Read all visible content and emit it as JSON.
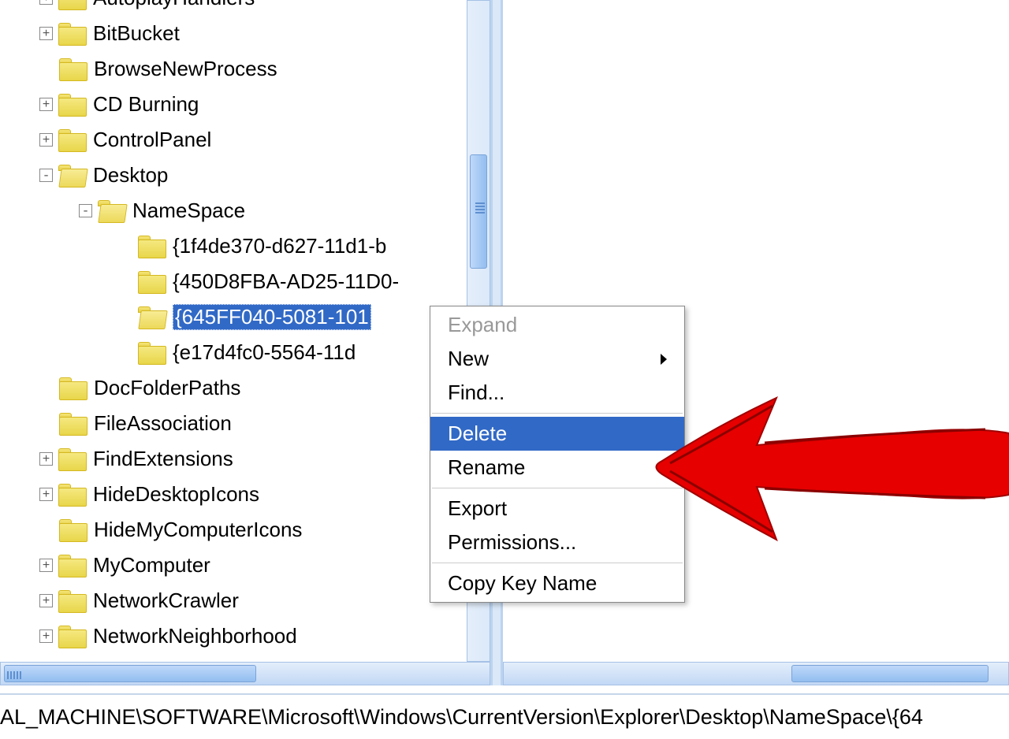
{
  "tree": {
    "items": [
      {
        "label": "AutoplayHandlers",
        "hasExpander": true,
        "expanderState": "+",
        "level": 1,
        "iconOpen": false
      },
      {
        "label": "BitBucket",
        "hasExpander": true,
        "expanderState": "+",
        "level": 1,
        "iconOpen": false
      },
      {
        "label": "BrowseNewProcess",
        "hasExpander": false,
        "level": 1,
        "iconOpen": false
      },
      {
        "label": "CD Burning",
        "hasExpander": true,
        "expanderState": "+",
        "level": 1,
        "iconOpen": false
      },
      {
        "label": "ControlPanel",
        "hasExpander": true,
        "expanderState": "+",
        "level": 1,
        "iconOpen": false
      },
      {
        "label": "Desktop",
        "hasExpander": true,
        "expanderState": "-",
        "level": 1,
        "iconOpen": true
      },
      {
        "label": "NameSpace",
        "hasExpander": true,
        "expanderState": "-",
        "level": 2,
        "iconOpen": true
      },
      {
        "label": "{1f4de370-d627-11d1-b",
        "hasExpander": false,
        "level": 3,
        "iconOpen": false
      },
      {
        "label": "{450D8FBA-AD25-11D0-",
        "hasExpander": false,
        "level": 3,
        "iconOpen": false
      },
      {
        "label": "{645FF040-5081-101",
        "hasExpander": false,
        "level": 3,
        "iconOpen": true,
        "selected": true
      },
      {
        "label": "{e17d4fc0-5564-11d",
        "hasExpander": false,
        "level": 3,
        "iconOpen": false
      },
      {
        "label": "DocFolderPaths",
        "hasExpander": false,
        "level": 1,
        "iconOpen": false
      },
      {
        "label": "FileAssociation",
        "hasExpander": false,
        "level": 1,
        "iconOpen": false
      },
      {
        "label": "FindExtensions",
        "hasExpander": true,
        "expanderState": "+",
        "level": 1,
        "iconOpen": false
      },
      {
        "label": "HideDesktopIcons",
        "hasExpander": true,
        "expanderState": "+",
        "level": 1,
        "iconOpen": false
      },
      {
        "label": "HideMyComputerIcons",
        "hasExpander": false,
        "level": 1,
        "iconOpen": false
      },
      {
        "label": "MyComputer",
        "hasExpander": true,
        "expanderState": "+",
        "level": 1,
        "iconOpen": false
      },
      {
        "label": "NetworkCrawler",
        "hasExpander": true,
        "expanderState": "+",
        "level": 1,
        "iconOpen": false
      },
      {
        "label": "NetworkNeighborhood",
        "hasExpander": true,
        "expanderState": "+",
        "level": 1,
        "iconOpen": false
      }
    ]
  },
  "contextMenu": {
    "items": [
      {
        "label": "Expand",
        "disabled": true
      },
      {
        "label": "New",
        "hasSubmenu": true
      },
      {
        "label": "Find...",
        "hasSubmenu": false
      },
      {
        "sep": true
      },
      {
        "label": "Delete",
        "highlighted": true
      },
      {
        "label": "Rename"
      },
      {
        "sep": true
      },
      {
        "label": "Export"
      },
      {
        "label": "Permissions..."
      },
      {
        "sep": true
      },
      {
        "label": "Copy Key Name"
      }
    ]
  },
  "statusBar": {
    "text": "AL_MACHINE\\SOFTWARE\\Microsoft\\Windows\\CurrentVersion\\Explorer\\Desktop\\NameSpace\\{64"
  }
}
